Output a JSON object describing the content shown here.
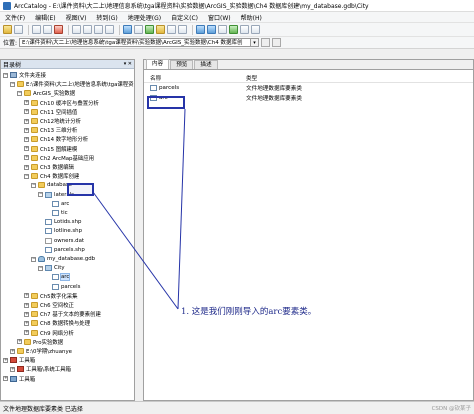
{
  "window": {
    "title": "ArcCatalog - E:\\课件资料\\大二上\\地理信息系统\\tga课程资料\\实验数据\\ArcGIS_实验数据\\Ch4 数据库创建\\my_database.gdb\\City"
  },
  "menu": [
    "文件(F)",
    "编辑(E)",
    "视图(V)",
    "转到(G)",
    "地理处理(G)",
    "自定义(C)",
    "窗口(W)",
    "帮助(H)"
  ],
  "location": {
    "label": "位置:",
    "value": "E:\\课件资料\\大二上\\地理信息系统\\tga课程资料\\实验数据\\ArcGIS_实验数据\\Ch4 数据库创"
  },
  "catalog_tree": {
    "header": "目录树",
    "pin": "▾ ✕",
    "nodes": [
      {
        "label": "文件夹连接",
        "depth": 0,
        "icon": "conn",
        "expander": "−"
      },
      {
        "label": "E:\\课件资料\\大二上\\地理信息系统\\tga课程资",
        "depth": 1,
        "icon": "folder",
        "expander": "−"
      },
      {
        "label": "ArcGIS_实验数据",
        "depth": 2,
        "icon": "folder",
        "expander": "−"
      },
      {
        "label": "Ch10 缓冲区与叠置分析",
        "depth": 3,
        "icon": "folder",
        "expander": "+"
      },
      {
        "label": "Ch11 空间插值",
        "depth": 3,
        "icon": "folder",
        "expander": "+"
      },
      {
        "label": "Ch12地统计分析",
        "depth": 3,
        "icon": "folder",
        "expander": "+"
      },
      {
        "label": "Ch13 三维分析",
        "depth": 3,
        "icon": "folder",
        "expander": "+"
      },
      {
        "label": "Ch14 数字地形分析",
        "depth": 3,
        "icon": "folder",
        "expander": "+"
      },
      {
        "label": "Ch15 图解建模",
        "depth": 3,
        "icon": "folder",
        "expander": "+"
      },
      {
        "label": "Ch2 ArcMap基础应用",
        "depth": 3,
        "icon": "folder",
        "expander": "+"
      },
      {
        "label": "Ch3 数据编辑",
        "depth": 3,
        "icon": "folder",
        "expander": "+"
      },
      {
        "label": "Ch4 数据库创建",
        "depth": 3,
        "icon": "folder",
        "expander": "−"
      },
      {
        "label": "database",
        "depth": 4,
        "icon": "folder",
        "expander": "−"
      },
      {
        "label": "laterals",
        "depth": 5,
        "icon": "fds",
        "expander": "−"
      },
      {
        "label": "arc",
        "depth": 6,
        "icon": "fc",
        "expander": ""
      },
      {
        "label": "tic",
        "depth": 6,
        "icon": "fc",
        "expander": ""
      },
      {
        "label": "Lotids.shp",
        "depth": 5,
        "icon": "fc",
        "expander": ""
      },
      {
        "label": "lotline.shp",
        "depth": 5,
        "icon": "fc",
        "expander": ""
      },
      {
        "label": "owners.dat",
        "depth": 5,
        "icon": "file",
        "expander": ""
      },
      {
        "label": "parcels.shp",
        "depth": 5,
        "icon": "fc",
        "expander": ""
      },
      {
        "label": "my_database.gdb",
        "depth": 4,
        "icon": "gdb",
        "expander": "−"
      },
      {
        "label": "City",
        "depth": 5,
        "icon": "fds",
        "expander": "−"
      },
      {
        "label": "arc",
        "depth": 6,
        "icon": "fc",
        "expander": ""
      },
      {
        "label": "parcels",
        "depth": 6,
        "icon": "fc",
        "expander": ""
      },
      {
        "label": "Ch5数字化采集",
        "depth": 3,
        "icon": "folder",
        "expander": "+"
      },
      {
        "label": "Ch6 空间校正",
        "depth": 3,
        "icon": "folder",
        "expander": "+"
      },
      {
        "label": "Ch7 基于文本的要素创建",
        "depth": 3,
        "icon": "folder",
        "expander": "+"
      },
      {
        "label": "Ch8 数据转换与处理",
        "depth": 3,
        "icon": "folder",
        "expander": "+"
      },
      {
        "label": "Ch9 网络分析",
        "depth": 3,
        "icon": "folder",
        "expander": "+"
      },
      {
        "label": "Pro实验数据",
        "depth": 2,
        "icon": "folder",
        "expander": "+"
      },
      {
        "label": "E:\\0学期\\zhuanye",
        "depth": 1,
        "icon": "folder",
        "expander": "+"
      },
      {
        "label": "工具箱",
        "depth": 0,
        "icon": "toolbox",
        "expander": "+"
      },
      {
        "label": "工具箱\\系统工具箱",
        "depth": 1,
        "icon": "toolbox",
        "expander": "+"
      },
      {
        "label": "工具箱",
        "depth": 0,
        "icon": "computer",
        "expander": "+"
      }
    ]
  },
  "contents": {
    "tabs": [
      "内容",
      "预览",
      "描述"
    ],
    "active_tab": 0,
    "columns": [
      "名称",
      "类型"
    ],
    "rows": [
      {
        "name": "parcels",
        "type": "文件地理数据库要素类"
      },
      {
        "name": "arc",
        "type": "文件地理数据库要素类"
      }
    ]
  },
  "annotation": {
    "text": "1. 这是我们刚刚导入的arc要素类。",
    "color": "#1f2a8a"
  },
  "status": {
    "left": "文件地理数据库要素类 已选择",
    "watermark": "CSDN @钦某子"
  }
}
